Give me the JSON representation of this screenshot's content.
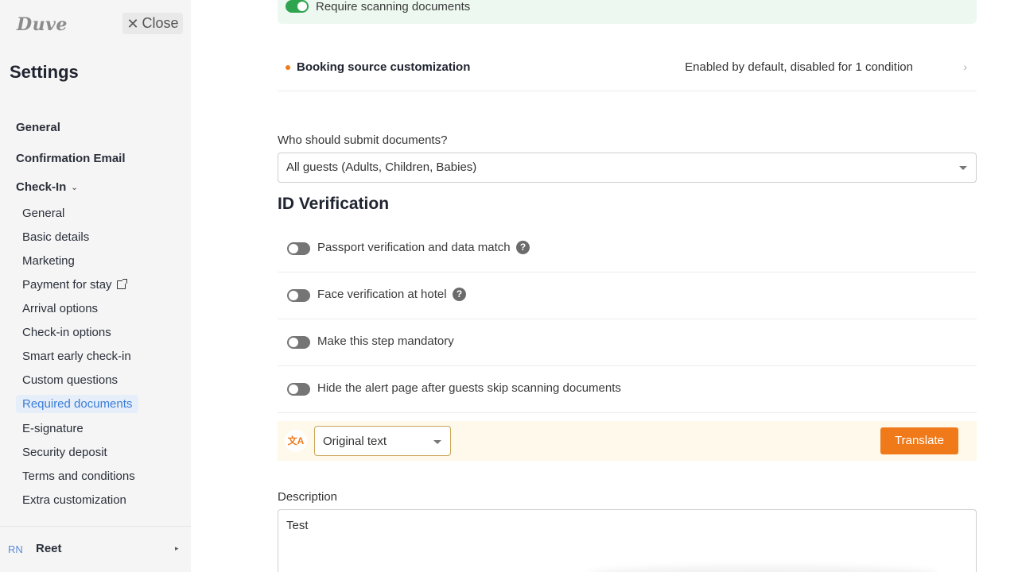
{
  "sidebar": {
    "logo": "Duve",
    "close_label": "Close",
    "title": "Settings",
    "top_items": [
      {
        "label": "General"
      },
      {
        "label": "Confirmation Email"
      },
      {
        "label": "Check-In"
      }
    ],
    "checkin_items": [
      {
        "label": "General"
      },
      {
        "label": "Basic details"
      },
      {
        "label": "Marketing"
      },
      {
        "label": "Payment for stay",
        "external": true
      },
      {
        "label": "Arrival options"
      },
      {
        "label": "Check-in options"
      },
      {
        "label": "Smart early check-in"
      },
      {
        "label": "Custom questions"
      },
      {
        "label": "Required documents",
        "active": true
      },
      {
        "label": "E-signature"
      },
      {
        "label": "Security deposit"
      },
      {
        "label": "Terms and conditions"
      },
      {
        "label": "Extra customization"
      }
    ],
    "user": {
      "initials": "RN",
      "name": "Reet"
    }
  },
  "main": {
    "scan_toggle": {
      "label": "Require scanning documents",
      "on": true
    },
    "booking_source": {
      "title": "Booking source customization",
      "status": "Enabled by default, disabled for 1 condition"
    },
    "who_submit": {
      "label": "Who should submit documents?",
      "value": "All guests (Adults, Children, Babies)"
    },
    "id_verification": {
      "title": "ID Verification",
      "options": [
        {
          "label": "Passport verification and data match",
          "on": false,
          "help": true
        },
        {
          "label": "Face verification at hotel",
          "on": false,
          "help": true
        },
        {
          "label": "Make this step mandatory",
          "on": false,
          "help": false
        },
        {
          "label": "Hide the alert page after guests skip scanning documents",
          "on": false,
          "help": false
        }
      ]
    },
    "translate": {
      "language_value": "Original text",
      "button_label": "Translate"
    },
    "description": {
      "label": "Description",
      "value": "Test"
    }
  },
  "colors": {
    "accent_orange": "#f07a1a",
    "toggle_on": "#2ea44f",
    "toggle_off": "#757575",
    "active_nav": "#3b7dd8",
    "banner_bg": "#edf8f0",
    "translate_bg": "#fef9ea"
  }
}
